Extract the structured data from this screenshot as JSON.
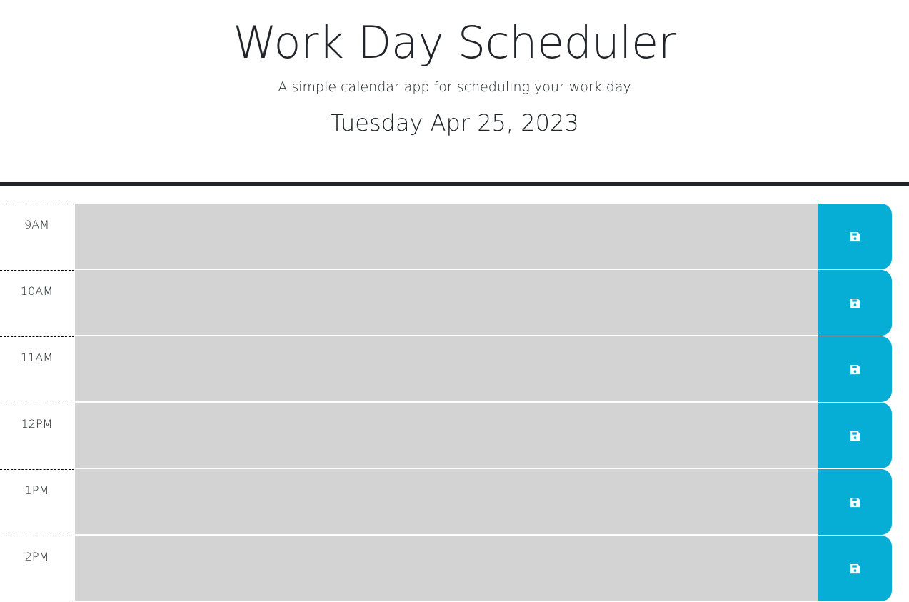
{
  "header": {
    "title": "Work Day Scheduler",
    "subtitle": "A simple calendar app for scheduling your work day",
    "current_day": "Tuesday Apr 25, 2023"
  },
  "colors": {
    "past_block": "#d3d3d3",
    "save_button": "#06aed5",
    "divider": "#212529"
  },
  "time_blocks": [
    {
      "hour": "9AM",
      "description": "",
      "save_icon": "floppy-disk-icon"
    },
    {
      "hour": "10AM",
      "description": "",
      "save_icon": "floppy-disk-icon"
    },
    {
      "hour": "11AM",
      "description": "",
      "save_icon": "floppy-disk-icon"
    },
    {
      "hour": "12PM",
      "description": "",
      "save_icon": "floppy-disk-icon"
    },
    {
      "hour": "1PM",
      "description": "",
      "save_icon": "floppy-disk-icon"
    },
    {
      "hour": "2PM",
      "description": "",
      "save_icon": "floppy-disk-icon"
    }
  ]
}
